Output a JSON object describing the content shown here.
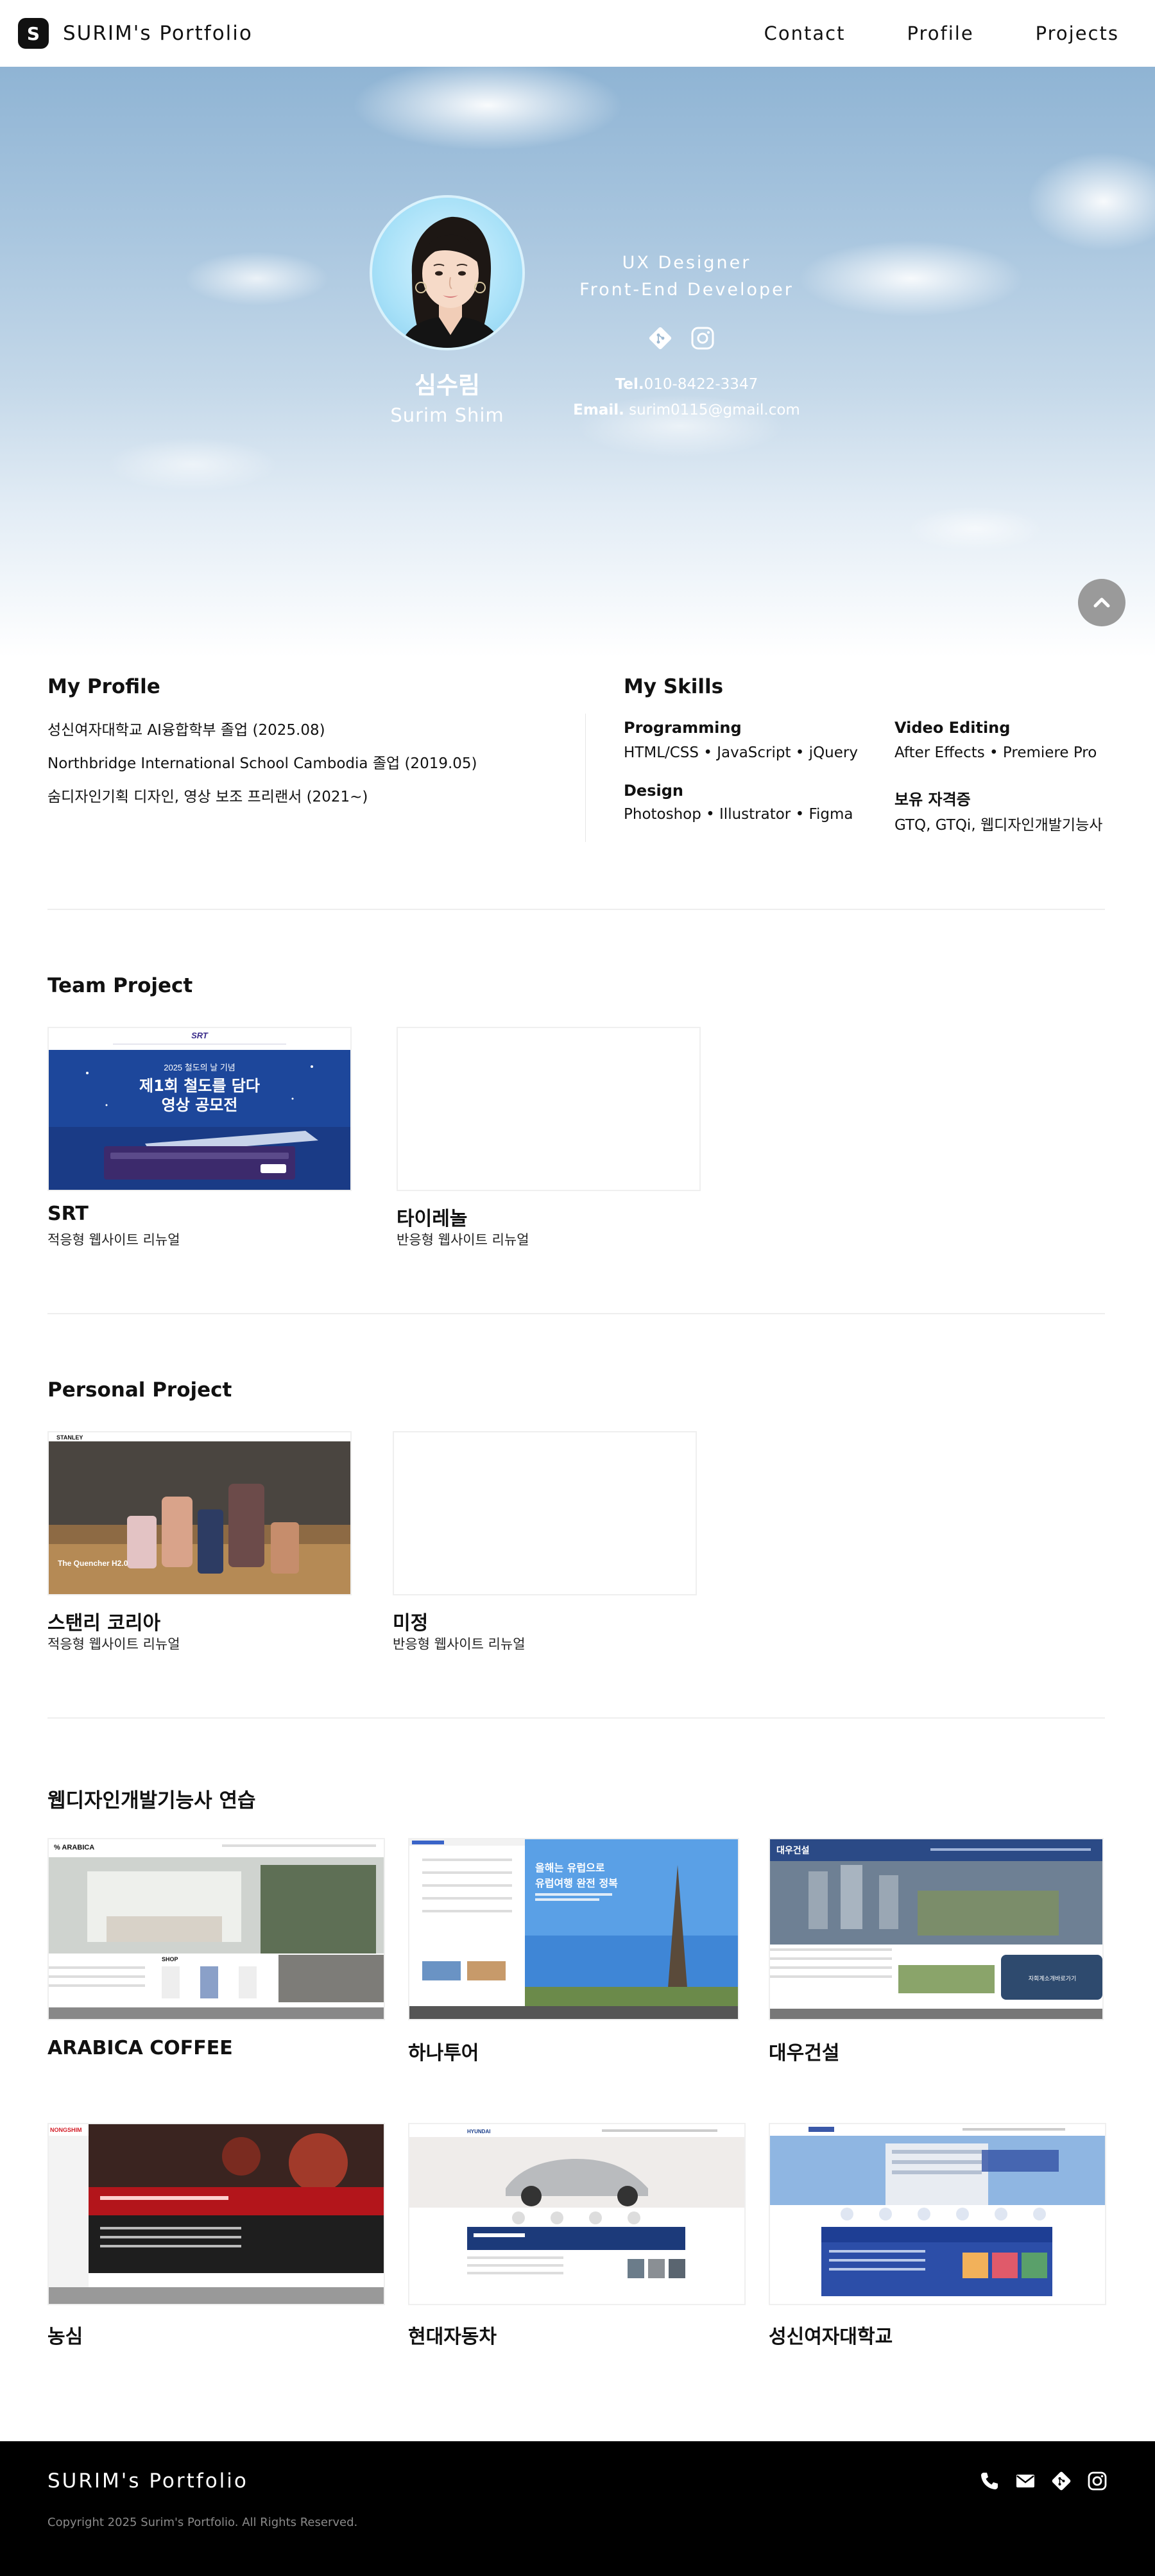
{
  "header": {
    "logo_letter": "S",
    "brand": "SURIM's Portfolio",
    "nav": [
      "Contact",
      "Profile",
      "Projects"
    ]
  },
  "hero": {
    "name_ko": "심수림",
    "name_en": "Surim Shim",
    "roles": [
      "UX Designer",
      "Front-End Developer"
    ],
    "icons": [
      "git-icon",
      "instagram-icon"
    ],
    "tel_label": "Tel.",
    "tel": "010-8422-3347",
    "email_label": "Email.",
    "email": "surim0115@gmail.com"
  },
  "profile": {
    "title": "My Profile",
    "lines": [
      "성신여자대학교 AI융합학부 졸업 (2025.08)",
      "Northbridge International School Cambodia 졸업 (2019.05)",
      "숨디자인기획 디자인, 영상 보조 프리랜서 (2021~)"
    ]
  },
  "skills": {
    "title": "My Skills",
    "programming_label": "Programming",
    "programming": "HTML/CSS • JavaScript • jQuery",
    "design_label": "Design",
    "design": "Photoshop • Illustrator • Figma",
    "video_label": "Video Editing",
    "video": "After Effects • Premiere Pro",
    "cert_label": "보유 자격증",
    "cert": "GTQ, GTQi, 웹디자인개발기능사"
  },
  "team": {
    "title": "Team Project",
    "cards": [
      {
        "title": "SRT",
        "subtitle": "적응형 웹사이트 리뉴얼",
        "thumb_logo": "SRT",
        "thumb_small": "2025 철도의 날 기념",
        "thumb_line1": "제1회 철도를 담다",
        "thumb_line2": "영상 공모전"
      },
      {
        "title": "타이레놀",
        "subtitle": "반응형 웹사이트 리뉴얼"
      }
    ]
  },
  "personal": {
    "title": "Personal Project",
    "cards": [
      {
        "title": "스탠리 코리아",
        "subtitle": "적응형 웹사이트 리뉴얼",
        "thumb_brand": "STANLEY",
        "thumb_caption": "The Quencher H2.0"
      },
      {
        "title": "미정",
        "subtitle": "반응형 웹사이트 리뉴얼"
      }
    ]
  },
  "practice": {
    "title": "웹디자인개발기능사 연습",
    "cards": [
      {
        "title": "ARABICA COFFEE",
        "thumb_logo": "% ARABICA",
        "thumb_shop": "SHOP"
      },
      {
        "title": "하나투어",
        "thumb_line1": "올해는 유럽으로",
        "thumb_line2": "유럽여행 완전 정복"
      },
      {
        "title": "대우건설",
        "thumb_logo": "대우건설",
        "thumb_button": "자회계소개바로가기"
      },
      {
        "title": "농심",
        "thumb_logo": "NONGSHIM"
      },
      {
        "title": "현대자동차",
        "thumb_logo": "HYUNDAI"
      },
      {
        "title": "성신여자대학교"
      }
    ]
  },
  "footer": {
    "brand": "SURIM's Portfolio",
    "copyright": "Copyright 2025 Surim's Portfolio. All Rights Reserved.",
    "icons": [
      "phone-icon",
      "mail-icon",
      "git-icon",
      "instagram-icon"
    ]
  },
  "colors": {
    "accent_dark": "#111111",
    "footer_bg": "#000000",
    "top_button": "#9a9a9a"
  }
}
